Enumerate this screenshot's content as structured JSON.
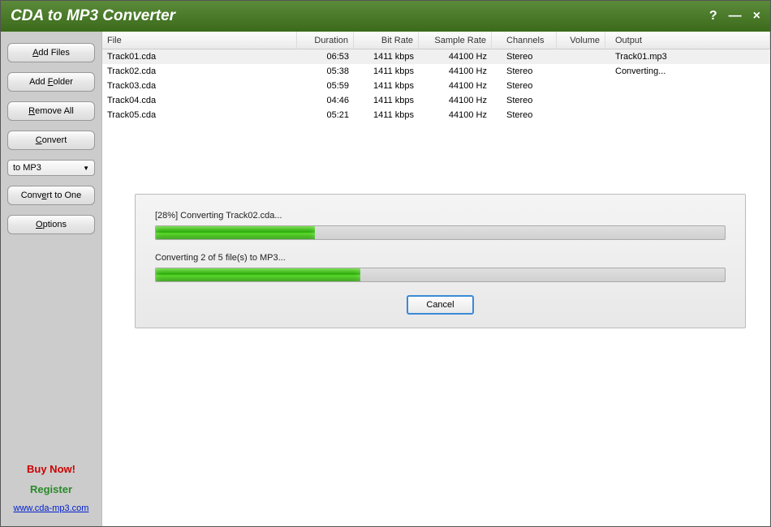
{
  "titlebar": {
    "title": "CDA to MP3 Converter"
  },
  "sidebar": {
    "add_files": "Add Files",
    "add_folder": "Add Folder",
    "remove_all": "Remove All",
    "convert": "Convert",
    "format_selected": "to MP3",
    "convert_to_one": "Convert to One",
    "options": "Options",
    "buy_now": "Buy Now!",
    "register": "Register",
    "website": "www.cda-mp3.com"
  },
  "table": {
    "headers": {
      "file": "File",
      "duration": "Duration",
      "bitrate": "Bit Rate",
      "samplerate": "Sample Rate",
      "channels": "Channels",
      "volume": "Volume",
      "output": "Output"
    },
    "rows": [
      {
        "file": "Track01.cda",
        "duration": "06:53",
        "bitrate": "1411 kbps",
        "samplerate": "44100 Hz",
        "channels": "Stereo",
        "volume": "",
        "output": "Track01.mp3",
        "selected": true
      },
      {
        "file": "Track02.cda",
        "duration": "05:38",
        "bitrate": "1411 kbps",
        "samplerate": "44100 Hz",
        "channels": "Stereo",
        "volume": "",
        "output": "Converting...",
        "selected": false
      },
      {
        "file": "Track03.cda",
        "duration": "05:59",
        "bitrate": "1411 kbps",
        "samplerate": "44100 Hz",
        "channels": "Stereo",
        "volume": "",
        "output": "",
        "selected": false
      },
      {
        "file": "Track04.cda",
        "duration": "04:46",
        "bitrate": "1411 kbps",
        "samplerate": "44100 Hz",
        "channels": "Stereo",
        "volume": "",
        "output": "",
        "selected": false
      },
      {
        "file": "Track05.cda",
        "duration": "05:21",
        "bitrate": "1411 kbps",
        "samplerate": "44100 Hz",
        "channels": "Stereo",
        "volume": "",
        "output": "",
        "selected": false
      }
    ]
  },
  "progress": {
    "current_label": "[28%] Converting Track02.cda...",
    "current_pct": 28,
    "overall_label": "Converting 2 of 5 file(s) to MP3...",
    "overall_pct": 36,
    "cancel": "Cancel"
  }
}
